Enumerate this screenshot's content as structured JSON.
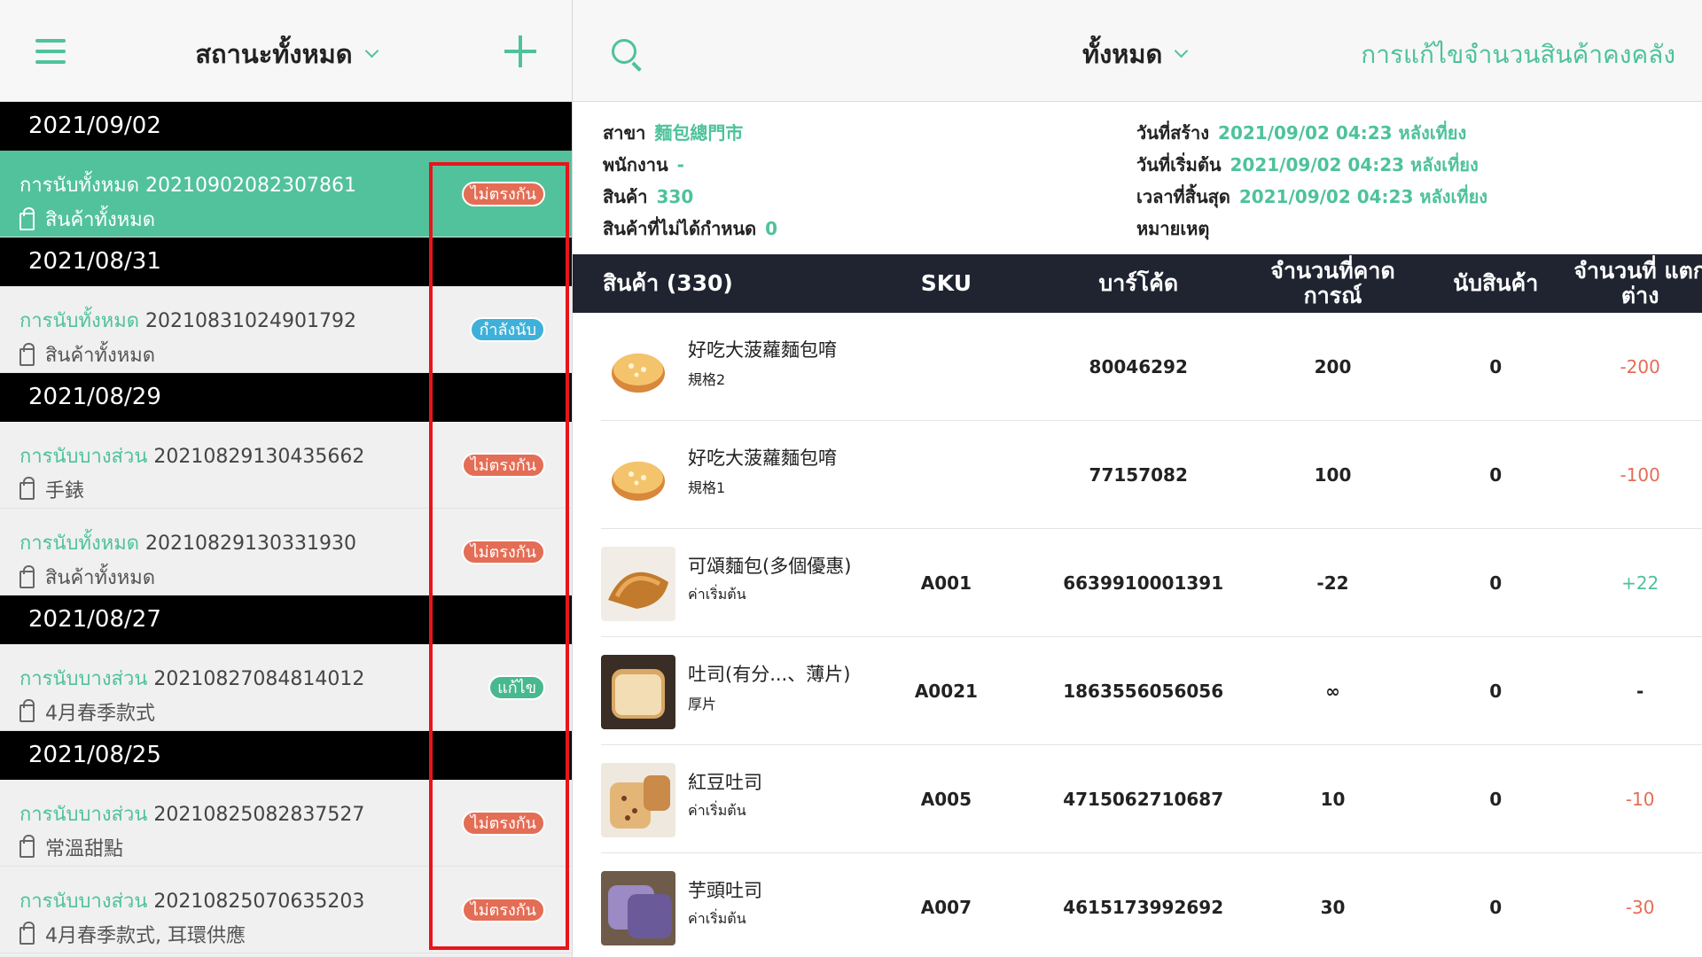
{
  "left_header": {
    "title": "สถานะทั้งหมด"
  },
  "groups": [
    {
      "date": "2021/09/02",
      "records": [
        {
          "kind": "การนับทั้งหมด",
          "id": "20210902082307861",
          "scope": "สินค้าทั้งหมด",
          "status": "ไม่ตรงกัน",
          "status_type": "red",
          "active": true
        }
      ]
    },
    {
      "date": "2021/08/31",
      "records": [
        {
          "kind": "การนับทั้งหมด",
          "id": "20210831024901792",
          "scope": "สินค้าทั้งหมด",
          "status": "กำลังนับ",
          "status_type": "blue",
          "active": false
        }
      ]
    },
    {
      "date": "2021/08/29",
      "records": [
        {
          "kind": "การนับบางส่วน",
          "id": "20210829130435662",
          "scope": "手錶",
          "status": "ไม่ตรงกัน",
          "status_type": "red",
          "active": false
        },
        {
          "kind": "การนับทั้งหมด",
          "id": "20210829130331930",
          "scope": "สินค้าทั้งหมด",
          "status": "ไม่ตรงกัน",
          "status_type": "red",
          "active": false
        }
      ]
    },
    {
      "date": "2021/08/27",
      "records": [
        {
          "kind": "การนับบางส่วน",
          "id": "20210827084814012",
          "scope": "4月春季款式",
          "status": "แก้ไข",
          "status_type": "green",
          "active": false
        }
      ]
    },
    {
      "date": "2021/08/25",
      "records": [
        {
          "kind": "การนับบางส่วน",
          "id": "20210825082837527",
          "scope": "常溫甜點",
          "status": "ไม่ตรงกัน",
          "status_type": "red",
          "active": false
        },
        {
          "kind": "การนับบางส่วน",
          "id": "20210825070635203",
          "scope": "4月春季款式, 耳環供應",
          "status": "ไม่ตรงกัน",
          "status_type": "red",
          "active": false
        }
      ]
    }
  ],
  "right_header": {
    "title": "ทั้งหมด",
    "action": "การแก้ไขจำนวนสินค้าคงคลัง"
  },
  "info": {
    "branch_label": "สาขา",
    "branch": "麵包總門市",
    "staff_label": "พนักงาน",
    "staff": "-",
    "product_label": "สินค้า",
    "product": "330",
    "unassigned_label": "สินค้าที่ไม่ได้กำหนด",
    "unassigned": "0",
    "created_label": "วันที่สร้าง",
    "created": "2021/09/02 04:23 หลังเที่ยง",
    "start_label": "วันที่เริ่มต้น",
    "start": "2021/09/02 04:23 หลังเที่ยง",
    "end_label": "เวลาที่สิ้นสุด",
    "end": "2021/09/02 04:23 หลังเที่ยง",
    "note_label": "หมายเหตุ"
  },
  "table": {
    "headers": [
      "สินค้า (330)",
      "SKU",
      "บาร์โค้ด",
      "จำนวนที่คาด การณ์",
      "นับสินค้า",
      "จำนวนที่ แตกต่าง"
    ],
    "rows": [
      {
        "name": "好吃大菠蘿麵包唷",
        "spec": "規格2",
        "sku": "",
        "barcode": "80046292",
        "expected": "200",
        "counted": "0",
        "diff": "-200",
        "diff_type": "neg",
        "image": "pineapple-bun"
      },
      {
        "name": "好吃大菠蘿麵包唷",
        "spec": "規格1",
        "sku": "",
        "barcode": "77157082",
        "expected": "100",
        "counted": "0",
        "diff": "-100",
        "diff_type": "neg",
        "image": "pineapple-bun"
      },
      {
        "name": "可頌麵包(多個優惠)",
        "spec": "ค่าเริ่มต้น",
        "sku": "A001",
        "barcode": "6639910001391",
        "expected": "-22",
        "counted": "0",
        "diff": "+22",
        "diff_type": "pos",
        "image": "croissant"
      },
      {
        "name": "吐司(有分...、薄片)",
        "spec": "厚片",
        "sku": "A0021",
        "barcode": "1863556056056",
        "expected": "∞",
        "counted": "0",
        "diff": "-",
        "diff_type": "plain",
        "image": "toast"
      },
      {
        "name": "紅豆吐司",
        "spec": "ค่าเริ่มต้น",
        "sku": "A005",
        "barcode": "4715062710687",
        "expected": "10",
        "counted": "0",
        "diff": "-10",
        "diff_type": "neg",
        "image": "red-bean-toast"
      },
      {
        "name": "芋頭吐司",
        "spec": "ค่าเริ่มต้น",
        "sku": "A007",
        "barcode": "4615173992692",
        "expected": "30",
        "counted": "0",
        "diff": "-30",
        "diff_type": "neg",
        "image": "taro-toast"
      }
    ]
  },
  "colors": {
    "accent": "#4ec29b",
    "negative": "#e46d55",
    "header_dark": "#1f2430",
    "highlight_box": "#e8151b"
  }
}
